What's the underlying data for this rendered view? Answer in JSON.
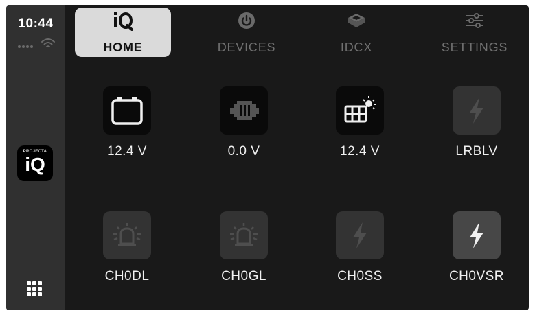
{
  "status": {
    "time": "10:44",
    "icons": [
      "cellular-signal-icon",
      "wifi-icon"
    ]
  },
  "dock": {
    "app_icon": {
      "brand": "PROJECTA",
      "logo": "iQ"
    },
    "apps_button_icon": "app-grid-icon"
  },
  "tabs": [
    {
      "label": "HOME",
      "icon": "iq-logo-icon",
      "active": true
    },
    {
      "label": "DEVICES",
      "icon": "power-icon",
      "active": false
    },
    {
      "label": "IDCX",
      "icon": "idcx-box-icon",
      "active": false
    },
    {
      "label": "SETTINGS",
      "icon": "sliders-icon",
      "active": false
    }
  ],
  "devices": [
    {
      "label": "12.4 V",
      "icon": "battery-icon"
    },
    {
      "label": "0.0 V",
      "icon": "engine-battery-icon"
    },
    {
      "label": "12.4 V",
      "icon": "solar-panel-icon"
    },
    {
      "label": "LRBLV",
      "icon": "lightning-icon"
    },
    {
      "label": "CH0DL",
      "icon": "beacon-light-icon"
    },
    {
      "label": "CH0GL",
      "icon": "beacon-light-icon"
    },
    {
      "label": "CH0SS",
      "icon": "lightning-icon"
    },
    {
      "label": "CH0VSR",
      "icon": "lightning-icon"
    }
  ],
  "colors": {
    "background": "#191919",
    "dock": "#303030",
    "active_tab": "#dadada",
    "inactive_text": "#707070"
  }
}
